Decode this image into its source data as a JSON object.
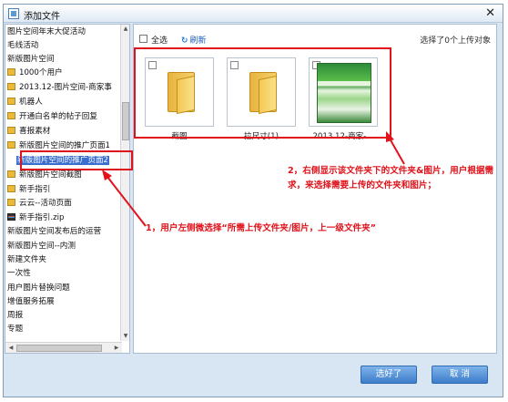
{
  "window": {
    "title": "添加文件",
    "close_glyph": "✕"
  },
  "tree": {
    "items": [
      {
        "label": "图片空间年末大促活动",
        "icon": "",
        "indent": false
      },
      {
        "label": "毛线活动",
        "icon": "",
        "indent": false
      },
      {
        "label": "新版图片空间",
        "icon": "",
        "indent": false
      },
      {
        "label": "1000个用户",
        "icon": "folder-icon",
        "indent": false
      },
      {
        "label": "2013.12-图片空间-商家事",
        "icon": "folder-icon",
        "indent": false
      },
      {
        "label": "机器人",
        "icon": "folder-icon",
        "indent": false
      },
      {
        "label": "开通白名单的帖子回复",
        "icon": "folder-icon",
        "indent": false
      },
      {
        "label": "喜报素材",
        "icon": "folder-icon",
        "indent": false
      },
      {
        "label": "新版图片空间的推广页面1",
        "icon": "folder-icon",
        "indent": false
      },
      {
        "label": "新版图片空间的推广页面2",
        "icon": "folder-icon",
        "indent": true,
        "selected": true
      },
      {
        "label": "新版图片空间截图",
        "icon": "folder-icon",
        "indent": false
      },
      {
        "label": "新手指引",
        "icon": "folder-icon",
        "indent": false
      },
      {
        "label": "云云--活动页面",
        "icon": "folder-icon",
        "indent": false
      },
      {
        "label": "新手指引.zip",
        "icon": "zip-icon",
        "indent": false
      },
      {
        "label": "新版图片空间发布后的运营",
        "icon": "",
        "indent": false
      },
      {
        "label": "新版图片空间--内测",
        "icon": "",
        "indent": false
      },
      {
        "label": "新建文件夹",
        "icon": "",
        "indent": false
      },
      {
        "label": "一次性",
        "icon": "",
        "indent": false
      },
      {
        "label": "用户图片替换问题",
        "icon": "",
        "indent": false
      },
      {
        "label": "增值服务拓展",
        "icon": "",
        "indent": false
      },
      {
        "label": "周报",
        "icon": "",
        "indent": false
      },
      {
        "label": "专题",
        "icon": "",
        "indent": false
      }
    ]
  },
  "toolbar": {
    "select_all": "全选",
    "refresh": "刷新",
    "refresh_icon": "refresh-icon",
    "selected_status": "选择了0个上传对象"
  },
  "files": [
    {
      "name": "截图",
      "type": "folder"
    },
    {
      "name": "拉尺寸(1)",
      "type": "folder"
    },
    {
      "name": "2013.12-商家-...",
      "type": "image"
    }
  ],
  "annotations": {
    "note_right": "2，右侧显示该文件夹下的文件夹&图片，用户根据需求，来选择需要上传的文件夹和图片；",
    "note_left": "1，用户左侧微选择“所需上传文件夹/图片，上一级文件夹”",
    "color": "#e0121a"
  },
  "footer": {
    "ok": "选好了",
    "cancel": "取 消"
  }
}
